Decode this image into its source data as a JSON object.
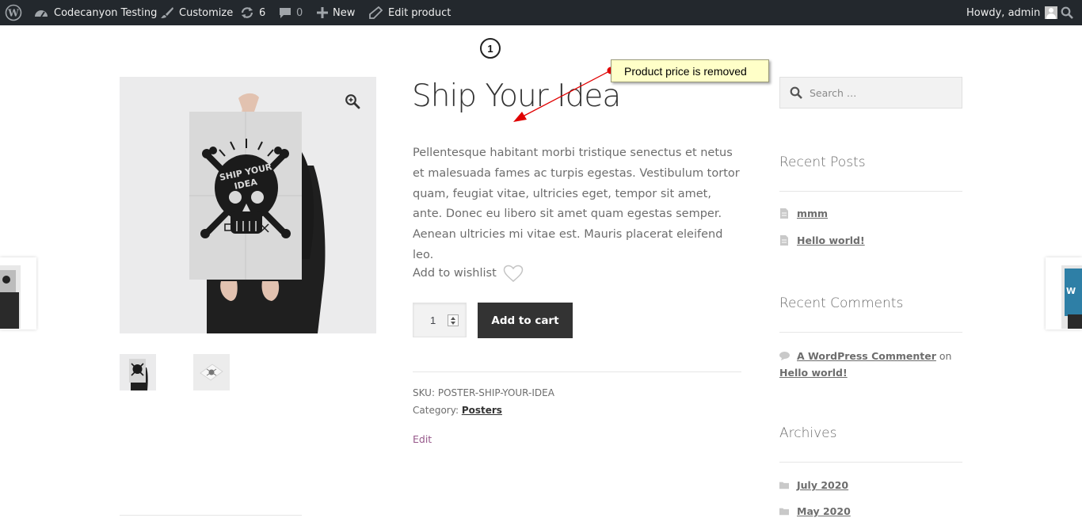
{
  "admin_bar": {
    "site_name": "Codecanyon Testing",
    "customize": "Customize",
    "updates_count": "6",
    "comments_count": "0",
    "new": "New",
    "edit_product": "Edit product",
    "howdy": "Howdy, admin"
  },
  "annotation": {
    "step": "1",
    "callout": "Product price is removed"
  },
  "product": {
    "title": "Ship Your Idea",
    "description": "Pellentesque habitant morbi tristique senectus et netus et malesuada fames ac turpis egestas. Vestibulum tortor quam, feugiat vitae, ultricies eget, tempor sit amet, ante. Donec eu libero sit amet quam egestas semper. Aenean ultricies mi vitae est. Mauris placerat eleifend leo.",
    "wishlist_label": "Add to wishlist",
    "quantity": "1",
    "add_to_cart": "Add to cart",
    "sku_label": "SKU:",
    "sku": "POSTER-SHIP-YOUR-IDEA",
    "category_label": "Category:",
    "category": "Posters",
    "edit": "Edit"
  },
  "sidebar": {
    "search_placeholder": "Search …",
    "recent_posts_title": "Recent Posts",
    "recent_posts": [
      {
        "label": "mmm"
      },
      {
        "label": "Hello world!"
      }
    ],
    "recent_comments_title": "Recent Comments",
    "recent_comment": {
      "author": "A WordPress Commenter",
      "on": "on",
      "post": "Hello world!"
    },
    "archives_title": "Archives",
    "archives": [
      {
        "label": "July 2020"
      },
      {
        "label": "May 2020"
      }
    ]
  },
  "colors": {
    "admin_bar": "#23282d",
    "button": "#333333",
    "link_purple": "#96588a",
    "callout_bg": "#ffffc8",
    "arrow": "#e00000"
  },
  "icons": [
    "wordpress-icon",
    "dashboard-icon",
    "brush-icon",
    "updates-icon",
    "comment-icon",
    "plus-icon",
    "pencil-icon",
    "admin-search-icon",
    "zoom-icon",
    "heart-icon",
    "search-icon",
    "document-icon",
    "speech-bubble-icon",
    "folder-icon"
  ]
}
